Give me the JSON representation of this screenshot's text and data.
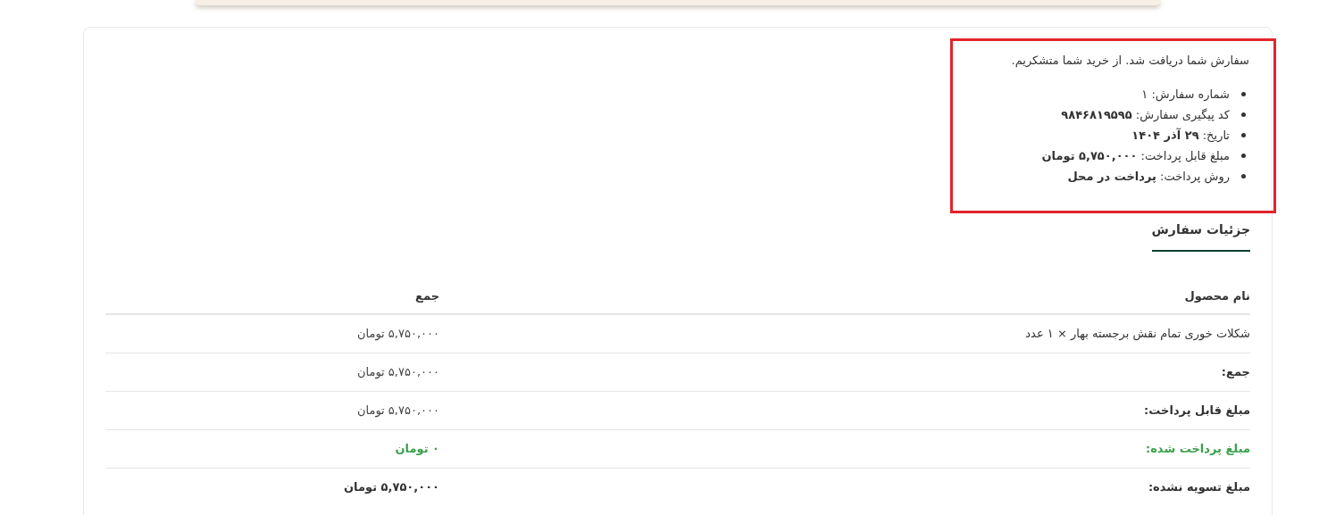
{
  "confirmation": {
    "message": "سفارش شما دریافت شد. از خرید شما متشکریم.",
    "details": [
      "شماره سفارش: ۱",
      "کد پیگیری سفارش: **۹۸۴۶۸۱۹۵۹۵**",
      "تاریخ: **۲۹ آذر ۱۴۰۴**",
      "مبلغ قابل پرداخت: **۵,۷۵۰,۰۰۰ تومان**",
      "روش پرداخت: **پرداخت در محل**"
    ]
  },
  "section_title": "جزئیات سفارش",
  "table": {
    "columns": [
      "نام محصول",
      "جمع"
    ],
    "rows": [
      {
        "kind": "item",
        "label": "شکلات خوری تمام نقش برجسته بهار × ۱ عدد",
        "value": "۵,۷۵۰,۰۰۰ تومان"
      },
      {
        "kind": "total",
        "label": "جمع:",
        "value": "۵,۷۵۰,۰۰۰ تومان"
      },
      {
        "kind": "total",
        "label": "مبلغ قابل پرداخت:",
        "value": "۵,۷۵۰,۰۰۰ تومان"
      },
      {
        "kind": "paid",
        "label": "مبلغ پرداخت شده:",
        "value": "۰ تومان"
      },
      {
        "kind": "due",
        "label": "مبلغ تسویه نشده:",
        "value": "۵,۷۵۰,۰۰۰ تومان"
      }
    ]
  }
}
